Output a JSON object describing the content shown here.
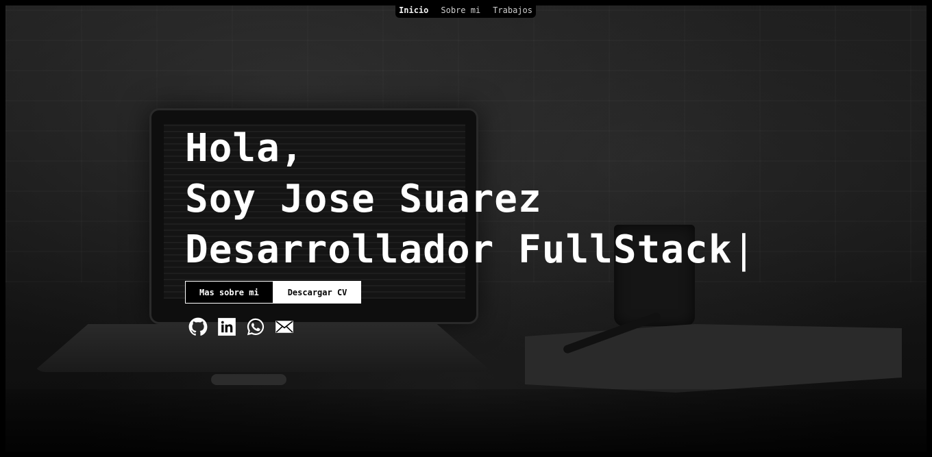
{
  "nav": {
    "items": [
      {
        "label": "Inicio",
        "active": true
      },
      {
        "label": "Sobre mi",
        "active": false
      },
      {
        "label": "Trabajos",
        "active": false
      }
    ]
  },
  "hero": {
    "line1": "Hola,",
    "line2": "Soy Jose Suarez",
    "line3": "Desarrollador FullStack",
    "cursor": "|"
  },
  "buttons": {
    "about_label": "Mas sobre mi",
    "cv_label": "Descargar CV"
  },
  "socials": [
    {
      "icon": "github-icon"
    },
    {
      "icon": "linkedin-icon"
    },
    {
      "icon": "whatsapp-icon"
    },
    {
      "icon": "email-icon"
    }
  ],
  "colors": {
    "background": "#000000",
    "text": "#ffffff",
    "nav_bg": "#000000"
  }
}
